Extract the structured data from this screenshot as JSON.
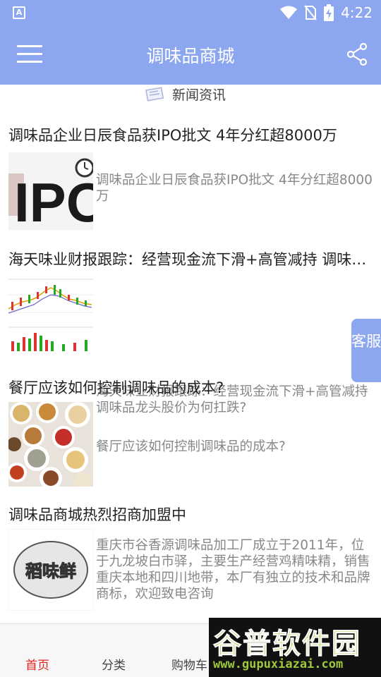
{
  "status_bar": {
    "notification_icon": "A",
    "time": "4:22",
    "icons": [
      "wifi-icon",
      "no-sim-icon",
      "battery-charging-icon"
    ]
  },
  "app_bar": {
    "title": "调味品商城",
    "menu_icon": "hamburger-menu-icon",
    "share_icon": "share-icon"
  },
  "section": {
    "title": "新闻资讯",
    "icon": "newspaper-icon"
  },
  "articles": [
    {
      "title": "调味品企业日辰食品获IPO批文 4年分红超8000万",
      "summary": "调味品企业日辰食品获IPO批文 4年分红超8000万",
      "thumb": "IPO"
    },
    {
      "title": "海天味业财报跟踪：经营现金流下滑+高管减持 调味品龙头股价为何扛跌?",
      "summary": "海天味业财报跟踪：经营现金流下滑+高管减持 调味品龙头股价为何扛跌?",
      "thumb": "stock-chart"
    },
    {
      "title": "餐厅应该如何控制调味品的成本?",
      "summary": "餐厅应该如何控制调味品的成本?",
      "thumb": "spice-bowls"
    },
    {
      "title": "调味品商城热烈招商加盟中",
      "summary": "重庆市谷香源调味品加工厂成立于2011年，位于九龙坡白市驿，主要生产经营鸡精味精，销售重庆本地和四川地带，本厂有独立的技术和品牌商标，欢迎致电咨询",
      "thumb": "稻味鲜"
    }
  ],
  "fab": {
    "label": "客服"
  },
  "bottom_nav": {
    "items": [
      {
        "label": "首页",
        "active": true
      },
      {
        "label": "分类",
        "active": false
      },
      {
        "label": "购物车",
        "active": false
      }
    ]
  },
  "watermark": {
    "main": "谷普软件园",
    "url": "www.gupuxiazai.com"
  },
  "colors": {
    "primary": "#8ca6f0",
    "active_nav": "#e8231d",
    "summary_text": "#888888"
  }
}
